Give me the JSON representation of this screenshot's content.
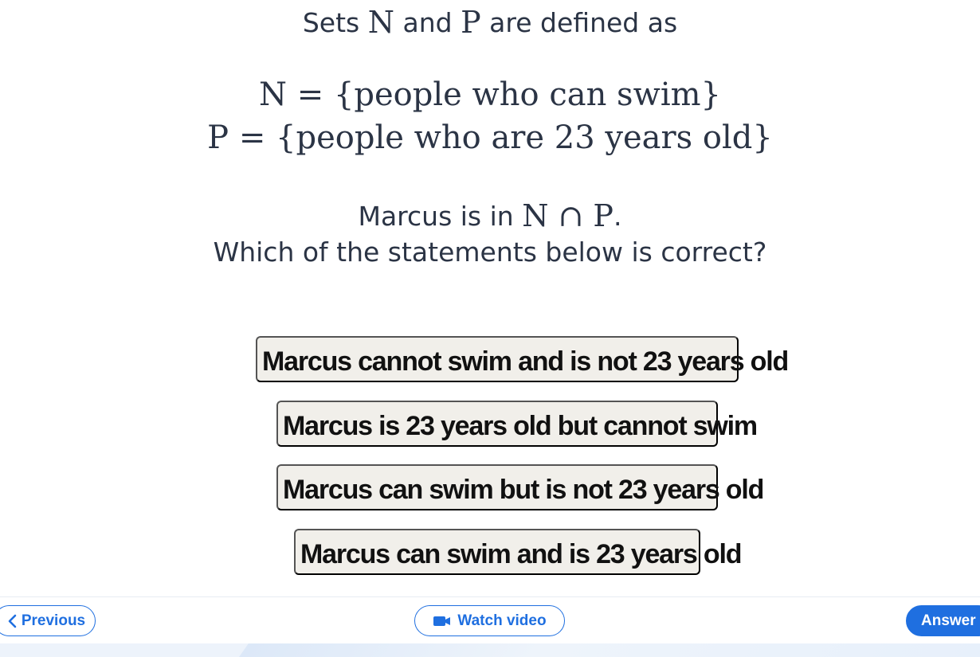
{
  "question": {
    "intro": {
      "prefix": "Sets",
      "set_n": "N",
      "middle": "and",
      "set_p": "P",
      "suffix": "are defined as"
    },
    "definitions": [
      {
        "set": "N",
        "equals": "=",
        "content": "{people who can swim}"
      },
      {
        "set": "P",
        "equals": "=",
        "content": "{people who are 23 years old}"
      }
    ],
    "membership": {
      "prefix": "Marcus is in",
      "expression": "N ∩ P",
      "suffix": "."
    },
    "prompt": "Which of the statements below is correct?"
  },
  "options": [
    "Marcus cannot swim and is not 23 years old",
    "Marcus is 23 years old but cannot swim",
    "Marcus can swim but is not 23 years old",
    "Marcus can swim and is 23 years old"
  ],
  "navigation": {
    "previous_label": "Previous",
    "watch_video_label": "Watch video",
    "answer_label": "Answer"
  },
  "icons": {
    "previous": "chevron-left-icon",
    "watch_video": "video-camera-icon"
  },
  "colors": {
    "text": "#2b3445",
    "option_background": "#f1efea",
    "accent": "#1f6fe0"
  }
}
